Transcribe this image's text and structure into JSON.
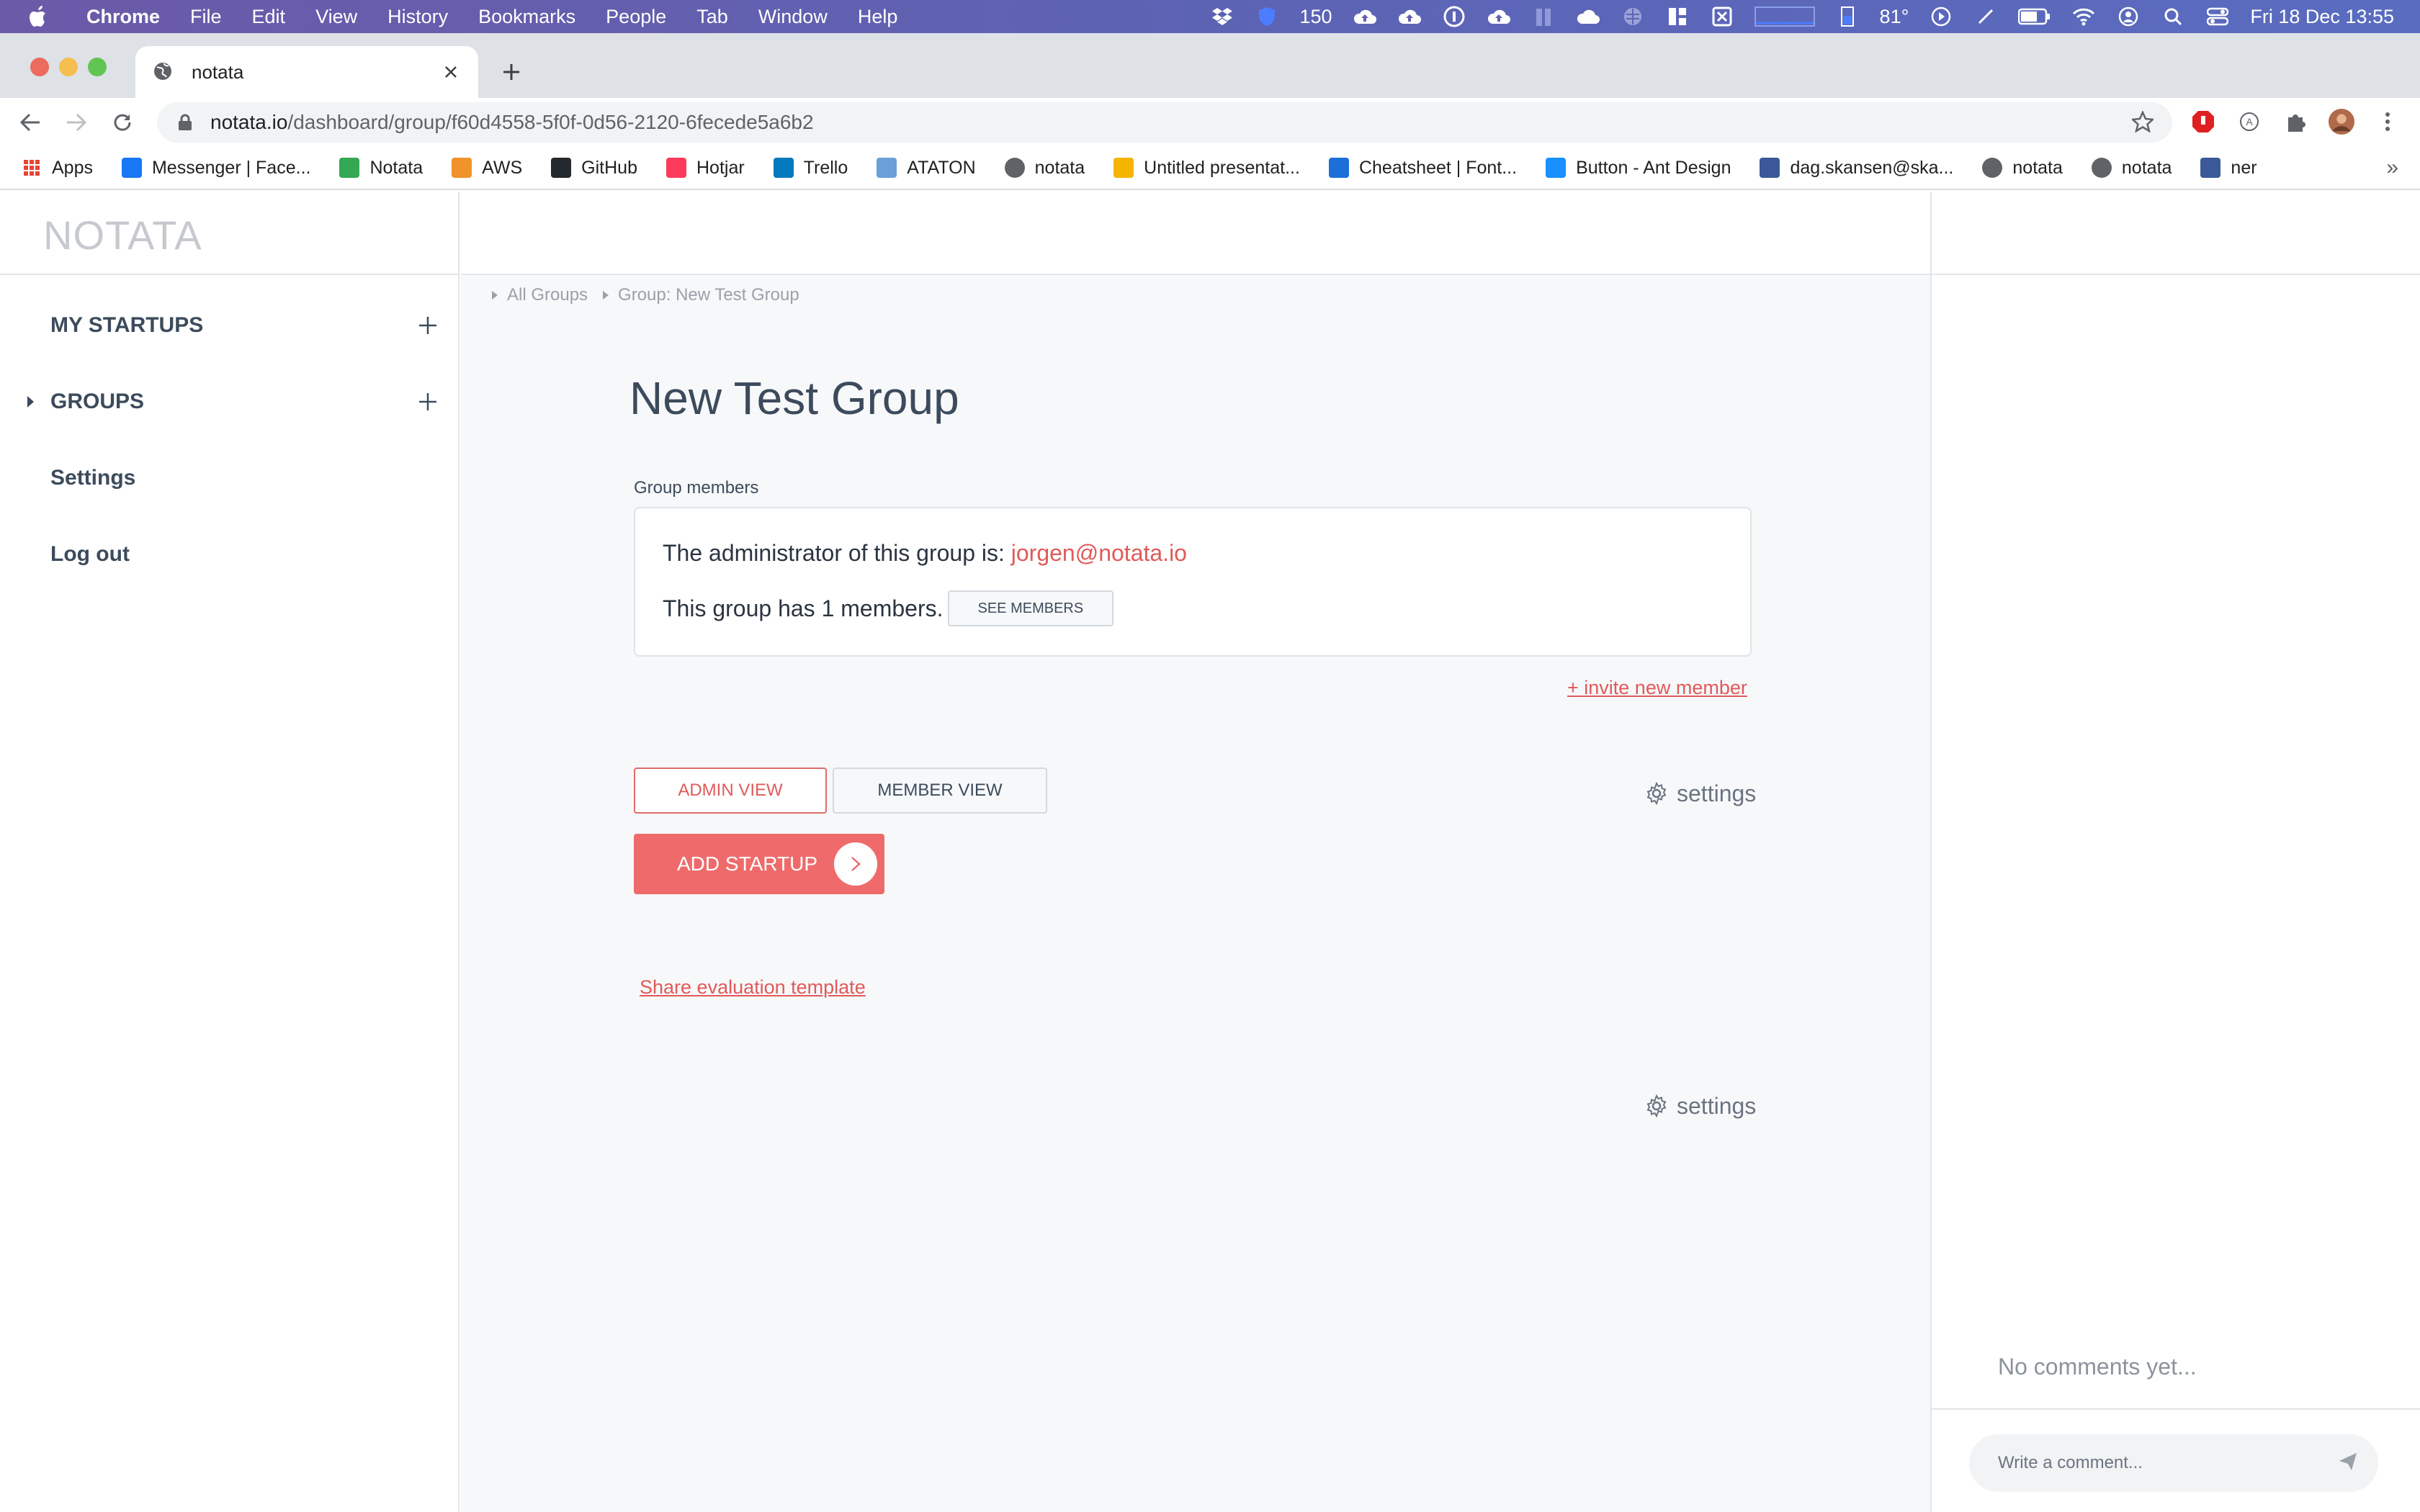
{
  "menubar": {
    "app": "Chrome",
    "items": [
      "File",
      "Edit",
      "View",
      "History",
      "Bookmarks",
      "People",
      "Tab",
      "Window",
      "Help"
    ],
    "status_count": "150",
    "temperature": "81°",
    "clock": "Fri 18 Dec  13:55"
  },
  "browser": {
    "tab_title": "notata",
    "url_host": "notata.io",
    "url_path": "/dashboard/group/f60d4558-5f0f-0d56-2120-6fecede5a6b2",
    "bookmarks": [
      {
        "label": "Apps",
        "icon": "apps-grid-icon",
        "color": "#4285f4"
      },
      {
        "label": "Messenger | Face...",
        "icon": "facebook-icon",
        "color": "#1877f2"
      },
      {
        "label": "Notata",
        "icon": "google-drive-icon",
        "color": "#34a853"
      },
      {
        "label": "AWS",
        "icon": "aws-cube-icon",
        "color": "#f0932b"
      },
      {
        "label": "GitHub",
        "icon": "github-icon",
        "color": "#24292e"
      },
      {
        "label": "Hotjar",
        "icon": "hotjar-flame-icon",
        "color": "#fd3a5c"
      },
      {
        "label": "Trello",
        "icon": "trello-icon",
        "color": "#0079bf"
      },
      {
        "label": "ATATON",
        "icon": "ataton-a-icon",
        "color": "#6aa0d8"
      },
      {
        "label": "notata",
        "icon": "globe-icon",
        "color": "#5f6368"
      },
      {
        "label": "Untitled presentat...",
        "icon": "slides-icon",
        "color": "#f4b400"
      },
      {
        "label": "Cheatsheet | Font...",
        "icon": "flag-icon",
        "color": "#1c6fd8"
      },
      {
        "label": "Button - Ant Design",
        "icon": "ant-design-icon",
        "color": "#1890ff"
      },
      {
        "label": "dag.skansen@ska...",
        "icon": "database-icon",
        "color": "#3b5998"
      },
      {
        "label": "notata",
        "icon": "globe-icon",
        "color": "#5f6368"
      },
      {
        "label": "notata",
        "icon": "globe-icon",
        "color": "#5f6368"
      },
      {
        "label": "ner",
        "icon": "database-icon",
        "color": "#3b5998"
      }
    ],
    "bookmarks_more": "»"
  },
  "sidebar": {
    "logo": "NOTATA",
    "my_startups": "MY STARTUPS",
    "groups": "GROUPS",
    "settings": "Settings",
    "logout": "Log out"
  },
  "breadcrumb": [
    "All Groups",
    "Group: New Test Group"
  ],
  "group": {
    "title": "New Test Group",
    "members_label": "Group members",
    "admin_text": "The administrator of this group is: ",
    "admin_email": "jorgen@notata.io",
    "members_text": "This group has 1 members.",
    "see_members": "SEE MEMBERS",
    "invite": "+ invite new member"
  },
  "views": {
    "admin": "ADMIN VIEW",
    "member": "MEMBER VIEW",
    "settings": "settings"
  },
  "actions": {
    "add_startup": "ADD STARTUP",
    "share_template": "Share evaluation template",
    "settings": "settings"
  },
  "comments": {
    "empty": "No comments yet...",
    "placeholder": "Write a comment..."
  },
  "colors": {
    "accent": "#ef6b6b",
    "link": "#e05a5a",
    "text": "#3c4b5c"
  }
}
